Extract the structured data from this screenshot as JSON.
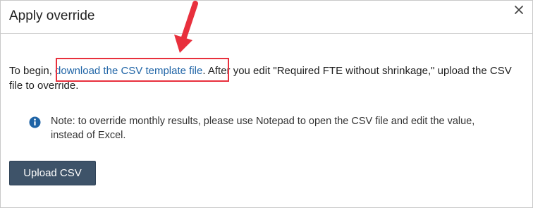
{
  "dialog": {
    "title": "Apply override",
    "intro_before": "To begin, ",
    "link_text": "download the CSV template file",
    "intro_after": ". After you edit \"Required FTE without shrinkage,\" upload the CSV file to override.",
    "note": "Note: to override monthly results, please use Notepad to open the CSV file and edit the value, instead of Excel.",
    "upload_label": "Upload CSV"
  },
  "icons": {
    "close": "close-icon",
    "info": "info-icon",
    "callout_arrow": "arrow-icon"
  },
  "colors": {
    "link": "#1f64a6",
    "button": "#3e5369",
    "highlight": "#e8303d",
    "info_icon": "#1f64a6"
  }
}
